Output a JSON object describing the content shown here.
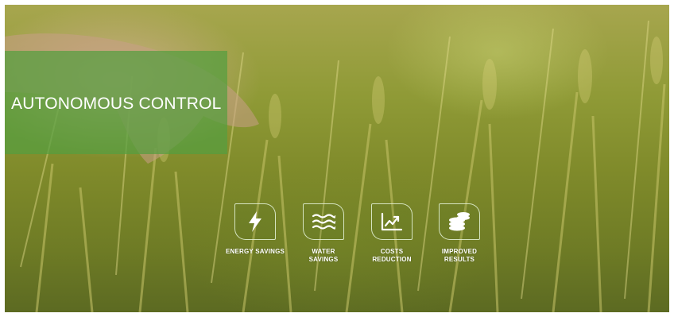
{
  "hero": {
    "title": "AUTONOMOUS CONTROL"
  },
  "benefits": [
    {
      "label": "ENERGY SAVINGS",
      "icon": "lightning-icon"
    },
    {
      "label": "WATER SAVINGS",
      "icon": "water-waves-icon"
    },
    {
      "label": "COSTS REDUCTION",
      "icon": "trend-chart-icon"
    },
    {
      "label": "IMPROVED RESULTS",
      "icon": "coin-stack-icon"
    }
  ],
  "colors": {
    "overlay": "#549E40",
    "text": "#FFFFFF",
    "icon_border": "#E1F0D2"
  }
}
